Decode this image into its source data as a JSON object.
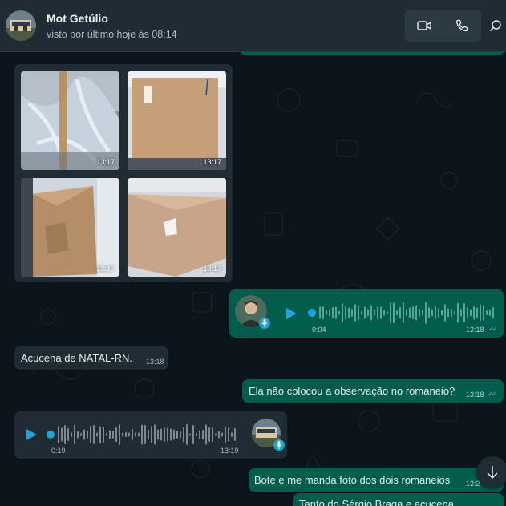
{
  "contact": {
    "name": "Mot Getúlio",
    "status": "visto por último hoje às 08:14"
  },
  "icons": {
    "video": "video-camera-icon",
    "call": "phone-icon",
    "search": "search-icon",
    "play": "play-icon",
    "mic": "microphone-icon",
    "scroll": "arrow-down-icon"
  },
  "colors": {
    "incoming": "#202c33",
    "outgoing": "#005c4b",
    "accent": "#1fa3d8",
    "read_ticks": "#53bdeb"
  },
  "messages": {
    "photos": [
      {
        "time": "13:17",
        "subject": "plastic wrap"
      },
      {
        "time": "13:17",
        "subject": "cardboard box"
      },
      {
        "time": "13:17",
        "subject": "damaged box"
      },
      {
        "time": "13:17",
        "subject": "torn box"
      }
    ],
    "audio_out": {
      "duration": "0:04",
      "time": "13:18",
      "progress": 0
    },
    "text_in_1": {
      "text": "Acucena de NATAL-RN.",
      "time": "13:18"
    },
    "text_out_1": {
      "text": "Ela não colocou a observação no romaneio?",
      "time": "13:18"
    },
    "audio_in": {
      "duration": "0:19",
      "time": "13:19",
      "progress": 0
    },
    "text_out_2": {
      "text": "Bote e me manda foto dos dois romaneios",
      "time": "13:2"
    },
    "text_out_3": {
      "text": "Tanto do Sérgio Braga e acucena"
    }
  }
}
